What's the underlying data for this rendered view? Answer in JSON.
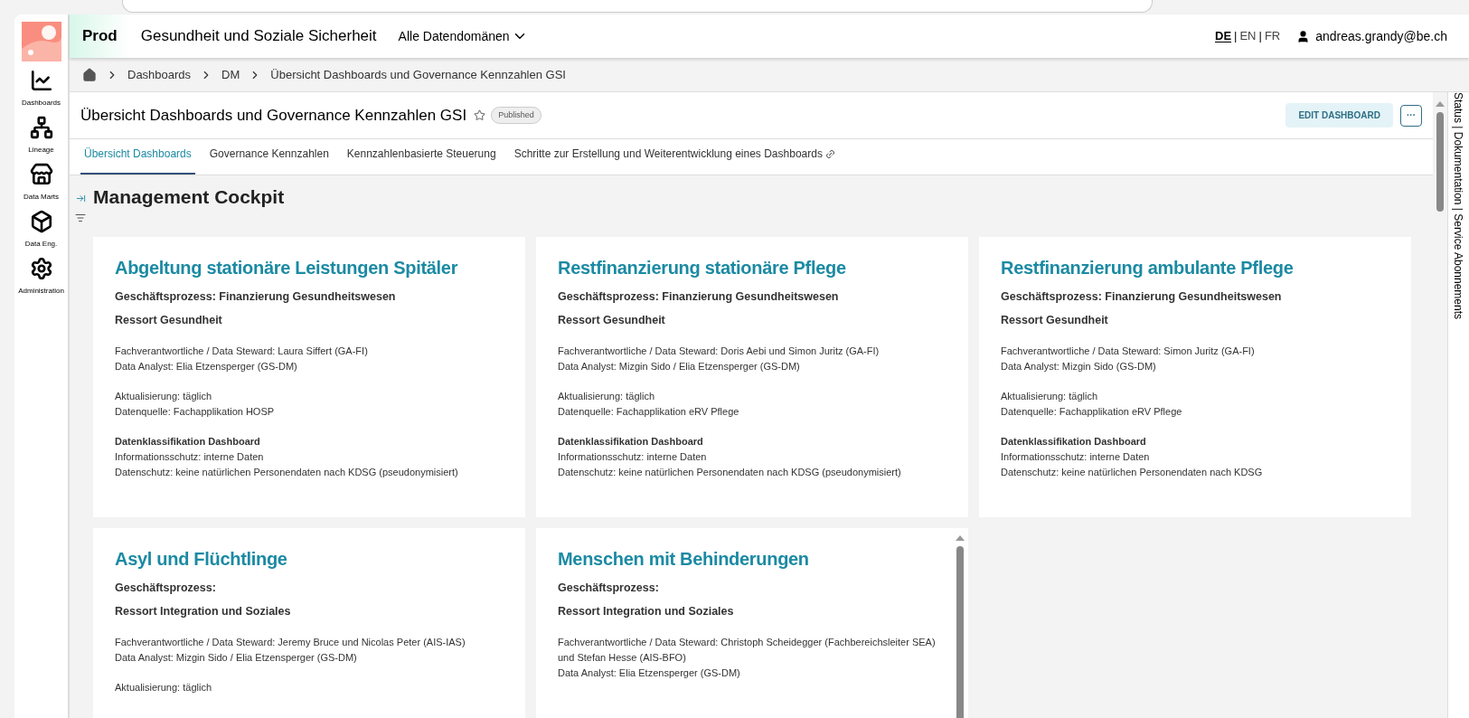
{
  "sidebar": {
    "items": [
      {
        "label": "Dashboards"
      },
      {
        "label": "Lineage"
      },
      {
        "label": "Data Marts"
      },
      {
        "label": "Data Eng."
      },
      {
        "label": "Administration"
      }
    ]
  },
  "header": {
    "environment": "Prod",
    "title": "Gesundheit und Soziale Sicherheit",
    "domain_menu": "Alle Datendomänen",
    "languages": [
      {
        "kind": "option",
        "label": "DE",
        "selected": true
      },
      {
        "kind": "separator",
        "label": "|"
      },
      {
        "kind": "option",
        "label": "EN",
        "selected": false
      },
      {
        "kind": "separator",
        "label": "|"
      },
      {
        "kind": "option",
        "label": "FR",
        "selected": false
      }
    ],
    "user": "andreas.grandy@be.ch"
  },
  "breadcrumb": [
    "Dashboards",
    "DM",
    "Übersicht Dashboards und Governance Kennzahlen GSI"
  ],
  "dashboard": {
    "title": "Übersicht Dashboards und Governance Kennzahlen GSI",
    "favorite": false,
    "status": "Published",
    "edit_button": "EDIT DASHBOARD",
    "more_button": "···"
  },
  "tabs": [
    {
      "label": "Übersicht Dashboards",
      "selected": true,
      "link": false
    },
    {
      "label": "Governance Kennzahlen",
      "selected": false,
      "link": false
    },
    {
      "label": "Kennzahlenbasierte Steuerung",
      "selected": false,
      "link": false
    },
    {
      "label": "Schritte zur Erstellung und Weiterentwicklung eines Dashboards",
      "selected": false,
      "link": true
    }
  ],
  "section_title": "Management Cockpit",
  "cards": [
    {
      "title": "Abgeltung stationäre Leistungen Spitäler",
      "process": "Geschäftsprozess: Finanzierung Gesundheitswesen",
      "ressort": "Ressort Gesundheit",
      "groups": [
        [
          "Fachverantwortliche / Data Steward: Laura Siffert (GA-FI)",
          "Data Analyst: Elia Etzensperger (GS-DM)"
        ],
        [
          "Aktualisierung: täglich",
          "Datenquelle: Fachapplikation HOSP"
        ]
      ],
      "classification": {
        "heading": "Datenklassifikation Dashboard",
        "lines": [
          "Informationsschutz: interne Daten",
          "Datenschutz: keine natürlichen Personendaten nach KDSG (pseudonymisiert)"
        ]
      },
      "scrollbar": false
    },
    {
      "title": "Restfinanzierung stationäre Pflege",
      "process": "Geschäftsprozess: Finanzierung Gesundheitswesen",
      "ressort": "Ressort Gesundheit",
      "groups": [
        [
          "Fachverantwortliche / Data Steward: Doris Aebi und Simon Juritz (GA-FI)",
          "Data Analyst: Mizgin Sido / Elia Etzensperger (GS-DM)"
        ],
        [
          "Aktualisierung: täglich",
          "Datenquelle: Fachapplikation eRV Pflege"
        ]
      ],
      "classification": {
        "heading": "Datenklassifikation Dashboard",
        "lines": [
          "Informationsschutz: interne Daten",
          "Datenschutz: keine natürlichen Personendaten nach KDSG (pseudonymisiert)"
        ]
      },
      "scrollbar": false
    },
    {
      "title": "Restfinanzierung ambulante Pflege",
      "process": "Geschäftsprozess: Finanzierung Gesundheitswesen",
      "ressort": "Ressort Gesundheit",
      "groups": [
        [
          "Fachverantwortliche / Data Steward: Simon Juritz (GA-FI)",
          "Data Analyst: Mizgin Sido (GS-DM)"
        ],
        [
          "Aktualisierung: täglich",
          "Datenquelle: Fachapplikation eRV Pflege"
        ]
      ],
      "classification": {
        "heading": "Datenklassifikation Dashboard",
        "lines": [
          "Informationsschutz: interne Daten",
          "Datenschutz: keine natürlichen Personendaten nach KDSG"
        ]
      },
      "scrollbar": false
    },
    {
      "title": "Asyl und Flüchtlinge",
      "process": "Geschäftsprozess:",
      "ressort": "Ressort Integration und Soziales",
      "groups": [
        [
          "Fachverantwortliche / Data Steward: Jeremy Bruce und Nicolas Peter (AIS-IAS)",
          "Data Analyst: Mizgin Sido / Elia Etzensperger (GS-DM)"
        ],
        [
          "Aktualisierung: täglich"
        ]
      ],
      "scrollbar": false
    },
    {
      "title": "Menschen mit Behinderungen",
      "process": "Geschäftsprozess:",
      "ressort": "Ressort Integration und Soziales",
      "groups": [
        [
          "Fachverantwortliche / Data Steward: Christoph Scheidegger (Fachbereichsleiter SEA) und Stefan Hesse (AIS-BFO)",
          "Data Analyst: Elia Etzensperger (GS-DM)"
        ]
      ],
      "scrollbar": true
    }
  ],
  "side_panel": "Status | Dokumentation | Service Abonnements"
}
